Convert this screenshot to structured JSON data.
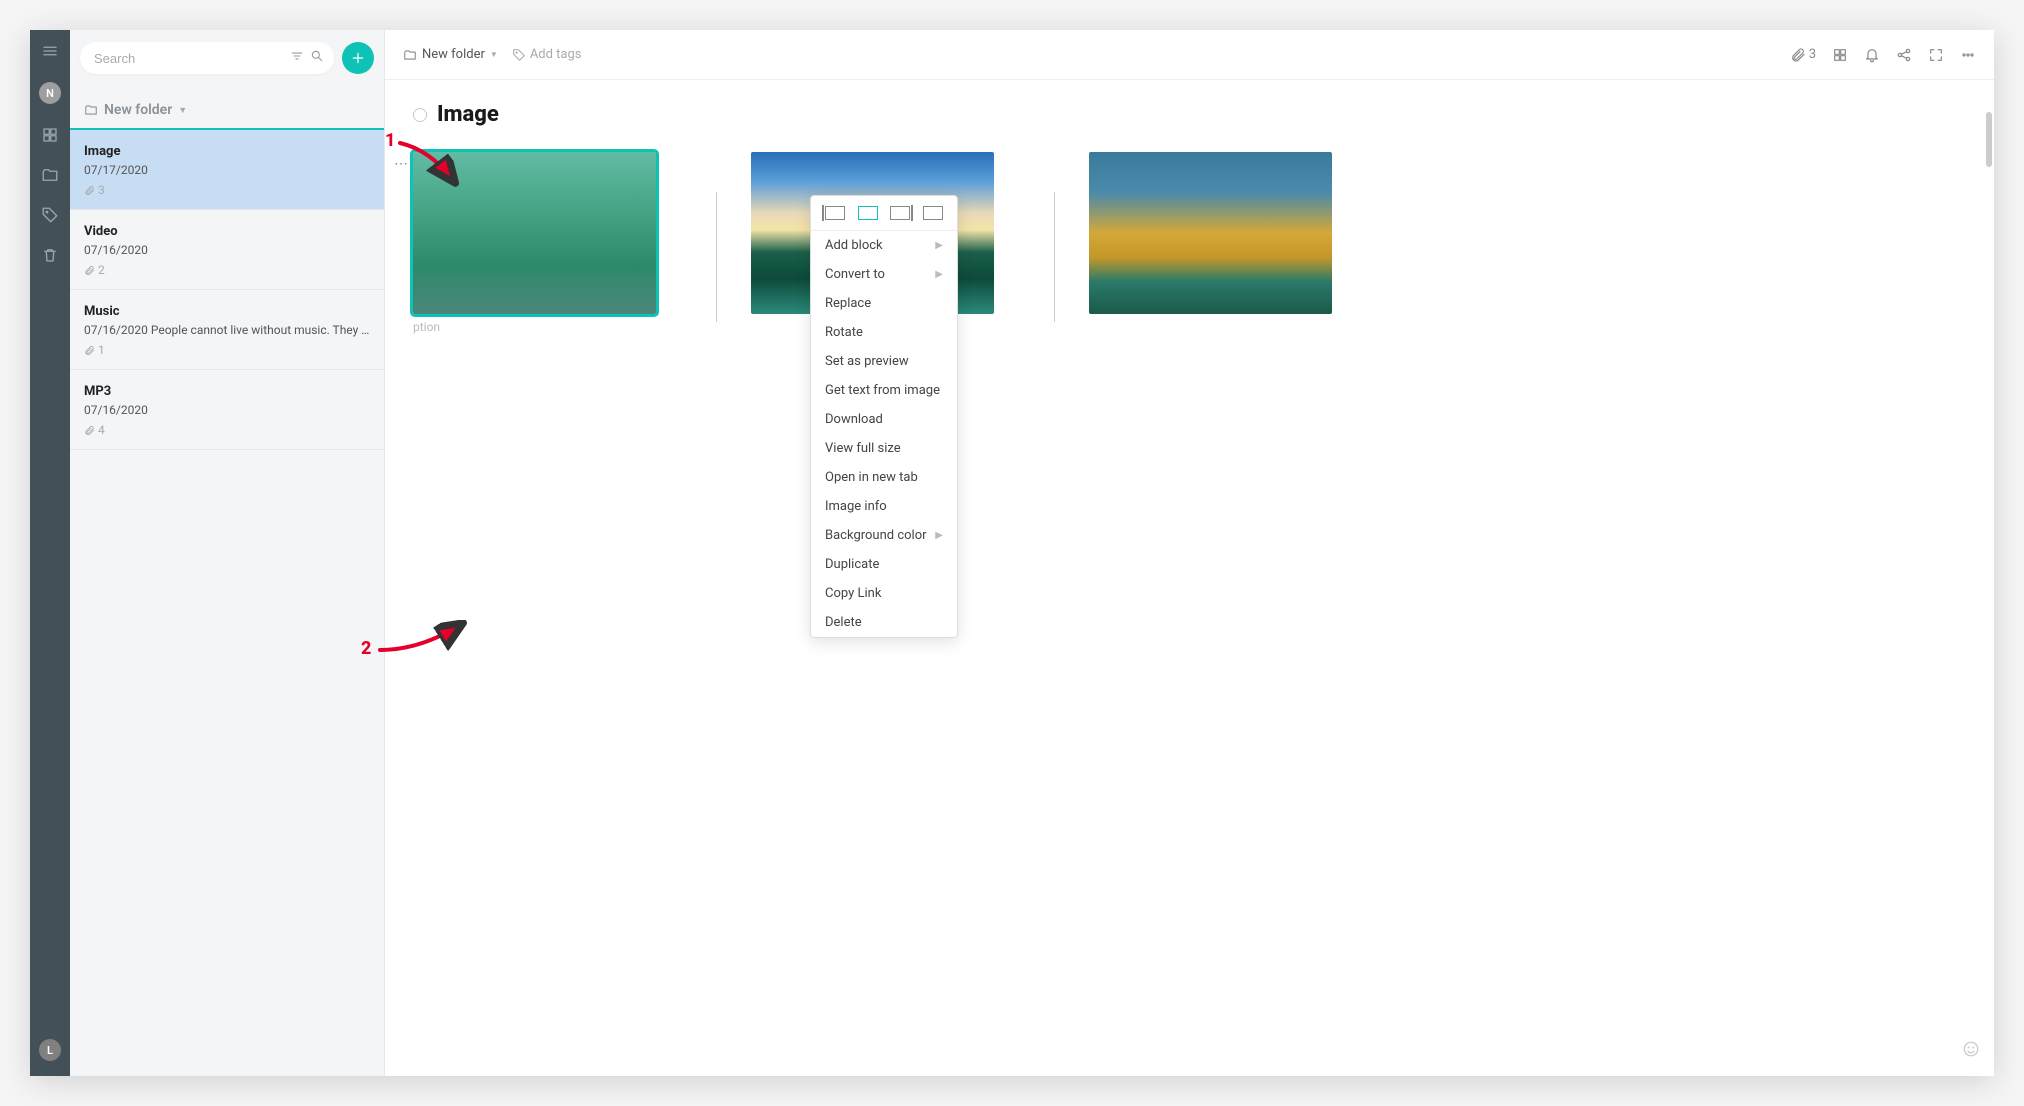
{
  "search": {
    "placeholder": "Search"
  },
  "rail_avatar": "N",
  "rail_bottom_avatar": "L",
  "folder_header": "New folder",
  "list": [
    {
      "title": "Image",
      "date": "07/17/2020",
      "excerpt": "",
      "attach": "3",
      "selected": true
    },
    {
      "title": "Video",
      "date": "07/16/2020",
      "excerpt": "",
      "attach": "2",
      "selected": false
    },
    {
      "title": "Music",
      "date": "07/16/2020",
      "excerpt": "People cannot live without music. They l...",
      "attach": "1",
      "selected": false
    },
    {
      "title": "MP3",
      "date": "07/16/2020",
      "excerpt": "",
      "attach": "4",
      "selected": false
    }
  ],
  "breadcrumb": "New folder",
  "add_tags": "Add tags",
  "attach_count": "3",
  "note_title": "Image",
  "caption_placeholder": "ption",
  "context_menu": {
    "add_block": "Add block",
    "convert_to": "Convert to",
    "replace": "Replace",
    "rotate": "Rotate",
    "set_preview": "Set as preview",
    "get_text": "Get text from image",
    "download": "Download",
    "view_full": "View full size",
    "open_tab": "Open in new tab",
    "image_info": "Image info",
    "bg_color": "Background color",
    "duplicate": "Duplicate",
    "copy_link": "Copy Link",
    "delete": "Delete"
  },
  "annotations": {
    "one": "1",
    "two": "2"
  }
}
